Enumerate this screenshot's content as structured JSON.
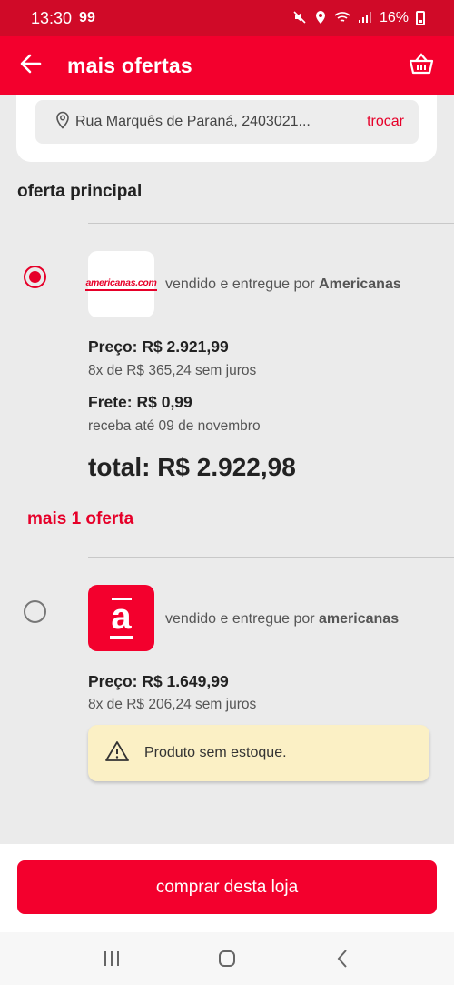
{
  "status_bar": {
    "time": "13:30",
    "notification": "99",
    "battery": "16%"
  },
  "app_bar": {
    "title": "mais ofertas"
  },
  "address": {
    "text": "Rua Marquês de Paraná, 2403021...",
    "change_label": "trocar"
  },
  "main_section": {
    "title": "oferta principal"
  },
  "offers": [
    {
      "selected": true,
      "logo_text": "americanas.com",
      "seller_prefix": "vendido e entregue por",
      "seller_name": "Americanas",
      "price": "Preço: R$ 2.921,99",
      "installments": "8x de R$ 365,24 sem juros",
      "shipping": "Frete: R$ 0,99",
      "delivery": "receba até 09 de novembro",
      "total": "total: R$ 2.922,98"
    },
    {
      "selected": false,
      "logo_text": "a",
      "seller_prefix": "vendido e entregue por",
      "seller_name": "americanas",
      "price": "Preço: R$ 1.649,99",
      "installments": "8x de R$ 206,24 sem juros",
      "warning": "Produto sem estoque."
    }
  ],
  "more_offers_label": "mais 1 oferta",
  "buy_button_label": "comprar desta loja",
  "colors": {
    "brand_red": "#f3002d",
    "status_red": "#d00a28",
    "warning_bg": "#fbf0c5"
  }
}
